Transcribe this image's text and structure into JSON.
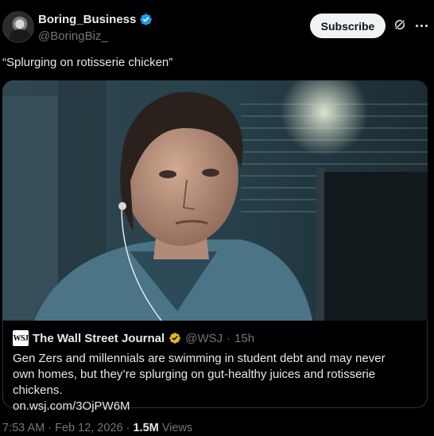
{
  "author": {
    "display_name": "Boring_Business",
    "handle": "@BoringBiz_"
  },
  "actions": {
    "subscribe_label": "Subscribe"
  },
  "tweet": {
    "text": "“Splurging on rotisserie chicken”"
  },
  "quote": {
    "logo_text": "WSJ",
    "name": "The Wall Street Journal",
    "handle": "@WSJ",
    "separator": "·",
    "time": "15h",
    "body": "Gen Zers and millennials are swimming in student debt and may never own homes, but they’re splurging on gut-healthy juices and rotisserie chickens.",
    "link": "on.wsj.com/3OjPW6M"
  },
  "meta": {
    "time": "7:53 AM",
    "separator1": "·",
    "date": "Feb 12, 2026",
    "separator2": "·",
    "views_count": "1.5M",
    "views_label": "Views"
  },
  "colors": {
    "background": "#000000",
    "text_primary": "#e7e9ea",
    "text_secondary": "#71767b",
    "verified_blue": "#1d9bf0",
    "verified_gold": "#e2b719",
    "border": "#2f3336"
  },
  "icons": {
    "verified": "verified-badge-icon",
    "grok": "grok-icon",
    "more": "more-icon"
  }
}
